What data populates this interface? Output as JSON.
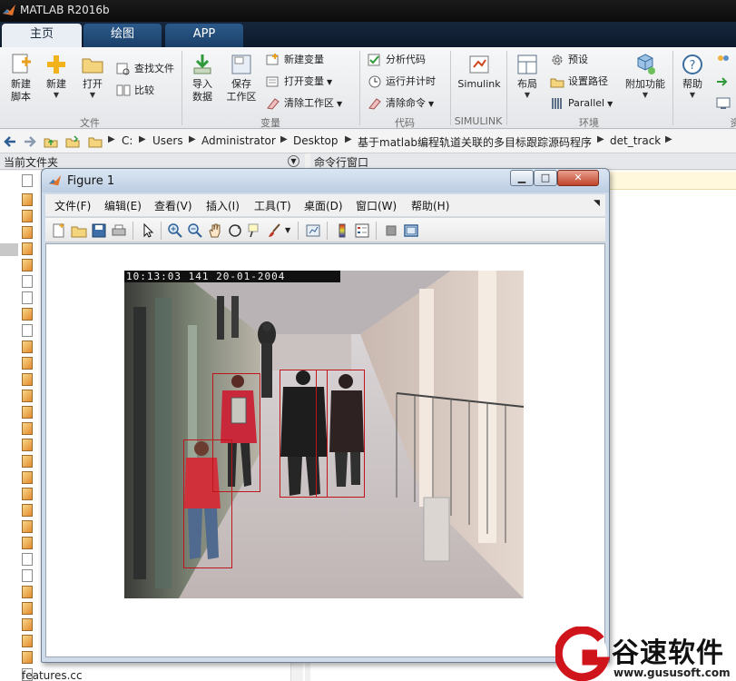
{
  "window": {
    "title": "MATLAB R2016b"
  },
  "tabs": [
    {
      "label": "主页",
      "active": true
    },
    {
      "label": "绘图",
      "active": false
    },
    {
      "label": "APP",
      "active": false
    }
  ],
  "ribbon": {
    "new_script": "新建\n脚本",
    "new": "新建",
    "open": "打开",
    "find_files": "查找文件",
    "compare": "比较",
    "group_file": "文件",
    "import_data": "导入\n数据",
    "save_workspace": "保存\n工作区",
    "new_variable": "新建变量",
    "open_variable": "打开变量",
    "clear_workspace": "清除工作区",
    "group_variable": "变量",
    "analyze_code": "分析代码",
    "run_and_time": "运行并计时",
    "clear_commands": "清除命令",
    "group_code": "代码",
    "simulink": "Simulink",
    "group_simulink": "SIMULINK",
    "layout": "布局",
    "preferences": "预设",
    "set_path": "设置路径",
    "parallel": "Parallel",
    "group_environment": "环境",
    "addons": "附加功能",
    "help": "帮助",
    "group_resources": "资"
  },
  "address": {
    "path": [
      "C:",
      "Users",
      "Administrator",
      "Desktop",
      "基于matlab编程轨道关联的多目标跟踪源码程序",
      "det_track"
    ]
  },
  "panels": {
    "current_folder": "当前文件夹",
    "command_window": "命令行窗口",
    "visible_file": "features.cc"
  },
  "figure": {
    "title": "Figure 1",
    "menus": [
      "文件(F)",
      "编辑(E)",
      "查看(V)",
      "插入(I)",
      "工具(T)",
      "桌面(D)",
      "窗口(W)",
      "帮助(H)"
    ],
    "video_timestamp": "10:13:03  141   20-01-2004"
  },
  "tracks": [
    {
      "id": "person-1"
    },
    {
      "id": "person-2"
    },
    {
      "id": "person-3"
    },
    {
      "id": "person-4"
    }
  ],
  "watermark": {
    "brand": "谷速软件",
    "url": "www.gususoft.com"
  },
  "colors": {
    "tab_active_bg": "#e9eef5",
    "tab_bg": "#1b4069",
    "track_box": "#c0141c"
  }
}
